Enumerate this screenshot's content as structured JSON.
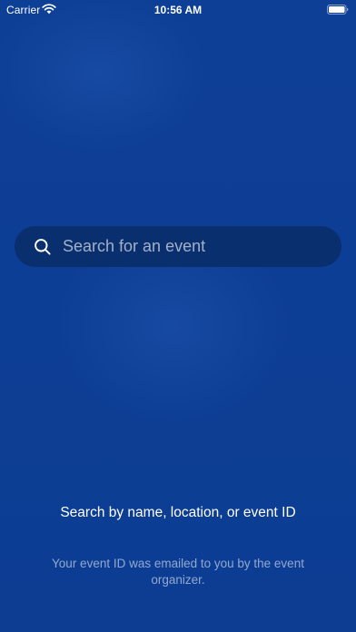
{
  "status_bar": {
    "carrier": "Carrier",
    "time": "10:56 AM",
    "wifi_icon": "wifi-icon",
    "battery_icon": "battery-icon"
  },
  "search": {
    "placeholder": "Search for an event",
    "value": "",
    "icon": "search-icon"
  },
  "help": {
    "title": "Search by name, location, or event ID",
    "subtitle": "Your event ID was emailed to you by the event organizer."
  },
  "colors": {
    "background": "#0d3f96",
    "search_field": "#0a2f6f",
    "text_primary": "#ffffff"
  }
}
